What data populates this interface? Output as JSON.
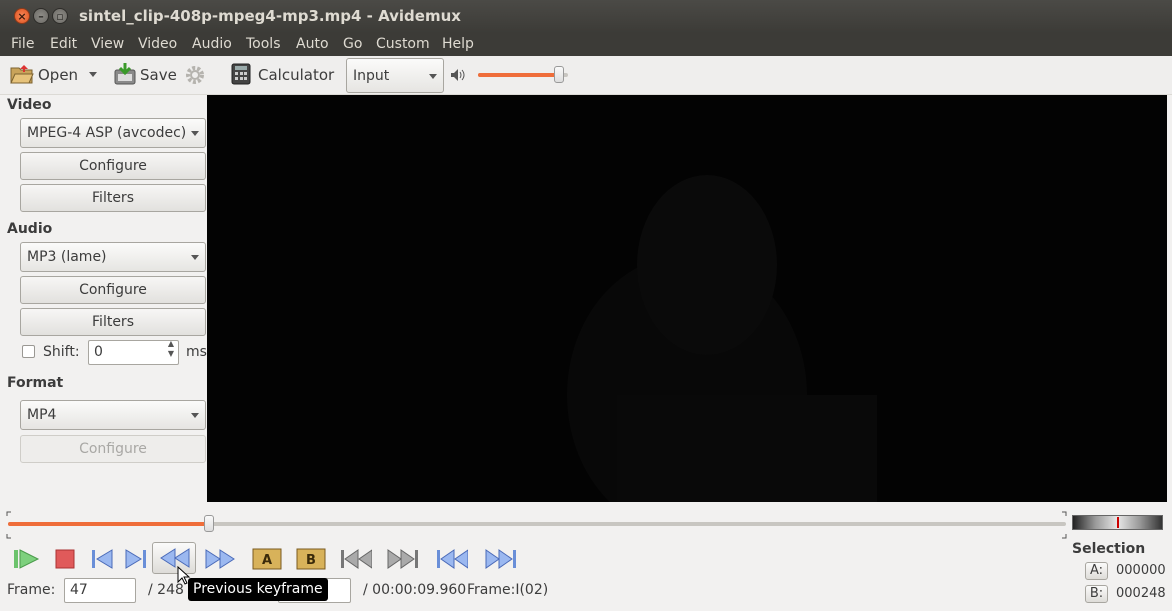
{
  "window": {
    "title": "sintel_clip-408p-mpeg4-mp3.mp4 - Avidemux"
  },
  "menu": [
    "File",
    "Edit",
    "View",
    "Video",
    "Audio",
    "Tools",
    "Auto",
    "Go",
    "Custom",
    "Help"
  ],
  "toolbar": {
    "open_label": "Open",
    "save_label": "Save",
    "calculator_label": "Calculator",
    "input_select": "Input",
    "volume_level": 0.9
  },
  "video": {
    "section_label": "Video",
    "codec": "MPEG-4 ASP (avcodec)",
    "configure_label": "Configure",
    "filters_label": "Filters"
  },
  "audio": {
    "section_label": "Audio",
    "codec": "MP3 (lame)",
    "configure_label": "Configure",
    "filters_label": "Filters",
    "shift_label": "Shift:",
    "shift_value": "0",
    "shift_unit": "ms"
  },
  "format": {
    "section_label": "Format",
    "container": "MP4",
    "configure_label": "Configure"
  },
  "timeline": {
    "position_fraction": 0.19
  },
  "status": {
    "frame_label": "Frame:",
    "frame_value": "47",
    "frame_total": "/ 248",
    "time_partial": "0",
    "time_total": "/ 00:00:09.960",
    "frame_type": "Frame:I(02)"
  },
  "tooltip": "Previous keyframe",
  "selection": {
    "title": "Selection",
    "a_label": "A:",
    "a_value": "000000",
    "b_label": "B:",
    "b_value": "000248"
  }
}
